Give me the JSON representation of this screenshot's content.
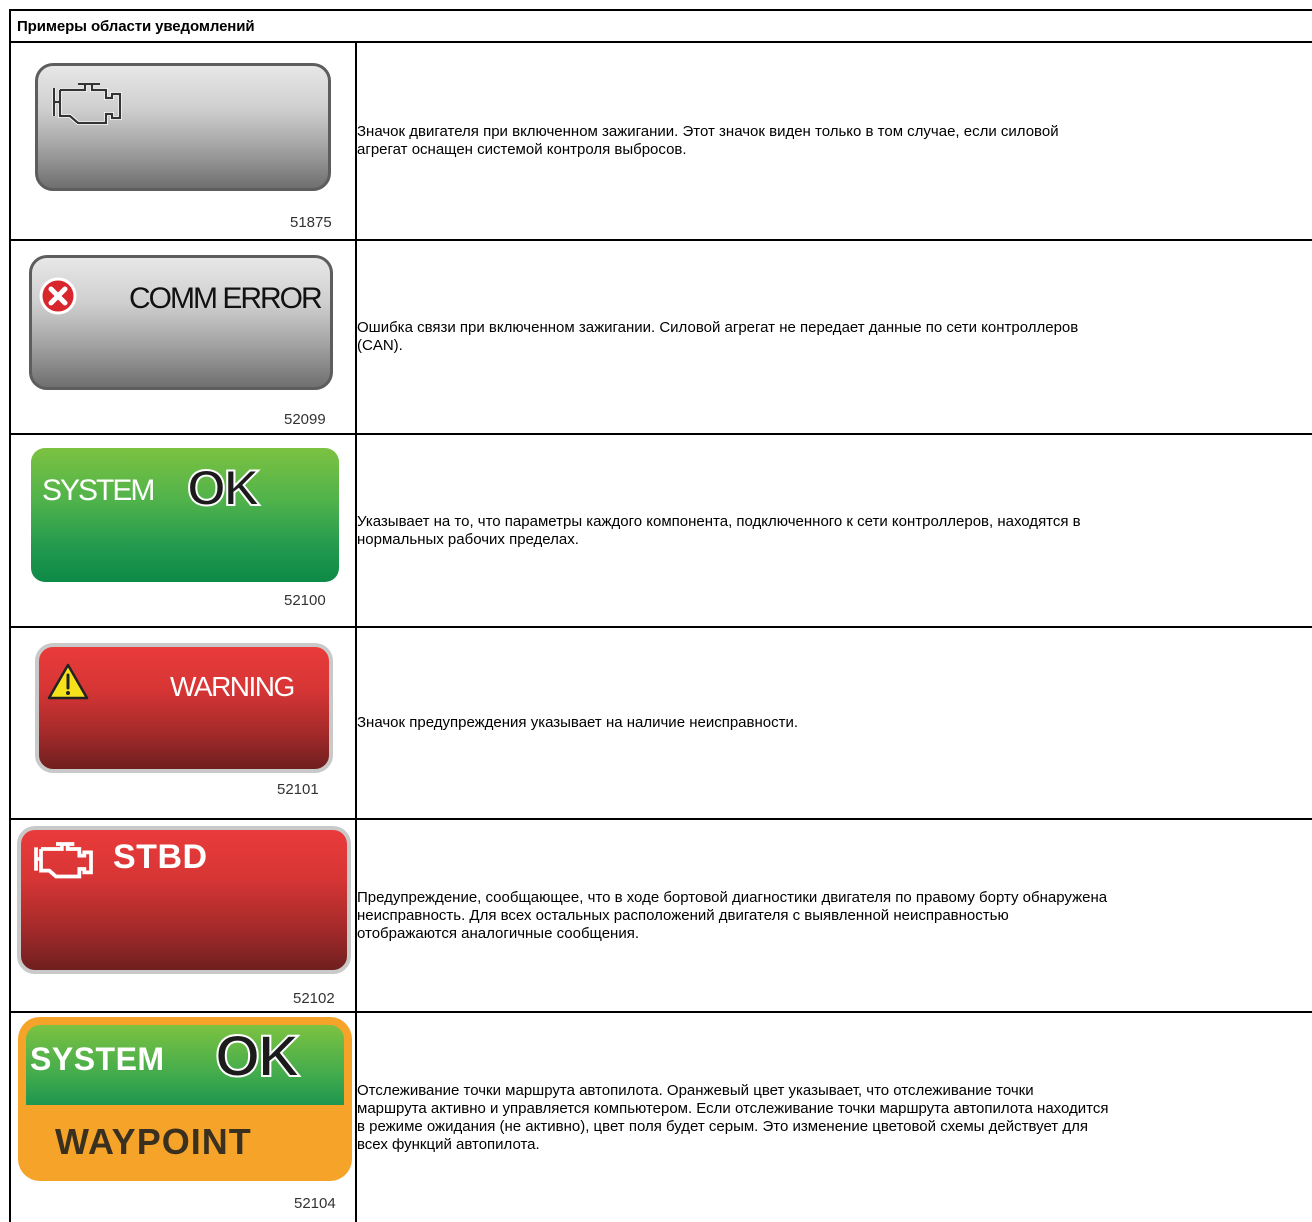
{
  "table": {
    "title": "Примеры области уведомлений"
  },
  "rows": [
    {
      "tile": {
        "kind": "engine",
        "icon": "engine-icon"
      },
      "figure": "51875",
      "description": "Значок двигателя при включенном зажигании. Этот значок виден только в том случае, если силовой\nагрегат оснащен системой контроля выбросов."
    },
    {
      "tile": {
        "kind": "comm-error",
        "label": "COMM ERROR",
        "icon": "error-x-icon"
      },
      "figure": "52099",
      "description": "Ошибка связи при включенном зажигании. Силовой агрегат не передает данные по сети контроллеров\n(CAN)."
    },
    {
      "tile": {
        "kind": "system-ok",
        "label_system": "SYSTEM",
        "label_ok": "OK"
      },
      "figure": "52100",
      "description": "Указывает на то, что параметры каждого компонента, подключенного к сети контроллеров, находятся в\nнормальных рабочих пределах."
    },
    {
      "tile": {
        "kind": "warning",
        "label": "WARNING",
        "icon": "warning-triangle-icon"
      },
      "figure": "52101",
      "description": "Значок предупреждения указывает на наличие неисправности."
    },
    {
      "tile": {
        "kind": "stbd",
        "label": "STBD",
        "icon": "engine-icon"
      },
      "figure": "52102",
      "description": "Предупреждение, сообщающее, что в ходе бортовой диагностики двигателя по правому борту обнаружена\nнеисправность. Для всех остальных расположений двигателя с выявленной неисправностью\nотображаются аналогичные сообщения."
    },
    {
      "tile": {
        "kind": "waypoint",
        "label_system": "SYSTEM",
        "label_ok": "OK",
        "label_mode": "WAYPOINT"
      },
      "figure": "52104",
      "description": "Отслеживание точки маршрута автопилота. Оранжевый цвет указывает, что отслеживание точки\nмаршрута активно и управляется компьютером. Если отслеживание точки маршрута автопилота находится\nв режиме ожидания (не активно), цвет поля будет серым. Это изменение цветовой схемы действует для\nвсех функций автопилота."
    }
  ],
  "colors": {
    "grey_tile": "#a6a6a6",
    "green_tile": "#21994f",
    "red_tile": "#c62f2f",
    "orange_frame": "#f6a32a",
    "error_red": "#d8262c",
    "warning_yellow": "#f5e21b"
  }
}
